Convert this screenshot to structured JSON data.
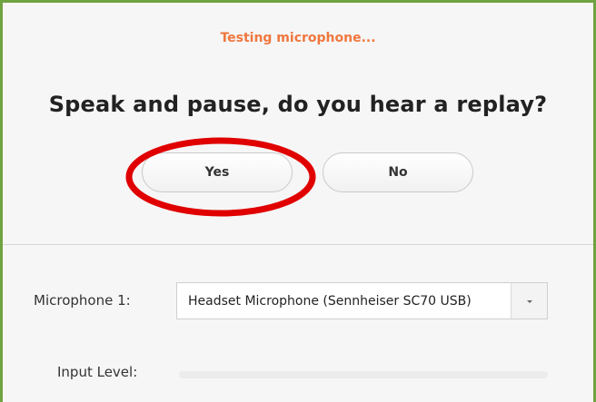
{
  "test": {
    "status": "Testing microphone...",
    "question": "Speak and pause, do you hear a replay?",
    "yes_label": "Yes",
    "no_label": "No"
  },
  "microphone": {
    "label": "Microphone 1:",
    "selected": "Headset Microphone (Sennheiser SC70 USB)",
    "dropdown_icon": "chevron-down-icon"
  },
  "input_level": {
    "label": "Input Level:",
    "level": 0
  },
  "colors": {
    "status": "#f0773e",
    "highlight": "#e00000",
    "frame": "#6fa240"
  }
}
